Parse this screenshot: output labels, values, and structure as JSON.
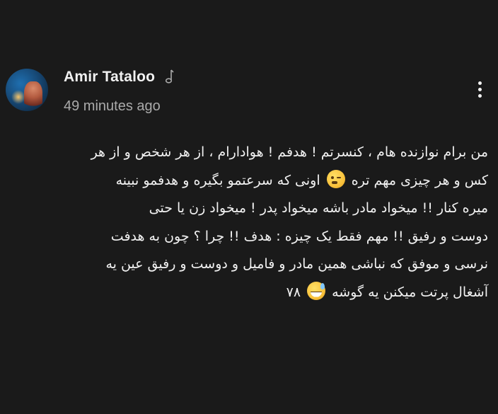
{
  "post": {
    "author": "Amir Tataloo",
    "author_badge_icon": "music-note-icon",
    "timestamp": "49 minutes ago",
    "menu_icon": "more-vertical-icon",
    "body_lines": [
      {
        "before": "من برام نوازنده هام ، کنسرتم ! هدفم ! هوادارام ، از هر شخص و از هر",
        "emoji": null,
        "after": ""
      },
      {
        "before": "کس و هر چیزی مهم تره",
        "emoji": "wink-face-emoji",
        "after": "اونی که سرعتمو بگیره و هدفمو نبینه"
      },
      {
        "before": "میره کنار !! میخواد مادر باشه میخواد پدر ! میخواد زن یا حتی",
        "emoji": null,
        "after": ""
      },
      {
        "before": "دوست و رفیق !! مهم فقط یک چیزه : هدف !! چرا ؟ چون به هدفت",
        "emoji": null,
        "after": ""
      },
      {
        "before": "نرسی و موفق که نباشی همین مادر و فامیل و دوست و رفیق عین یه",
        "emoji": null,
        "after": ""
      },
      {
        "before": "آشغال پرتت میکنن یه گوشه",
        "emoji": "grinning-sweat-emoji",
        "after": "۷۸"
      }
    ]
  },
  "colors": {
    "background": "#1a1a1a",
    "text_primary": "#f1f1f1",
    "text_secondary": "#aaaaaa"
  }
}
